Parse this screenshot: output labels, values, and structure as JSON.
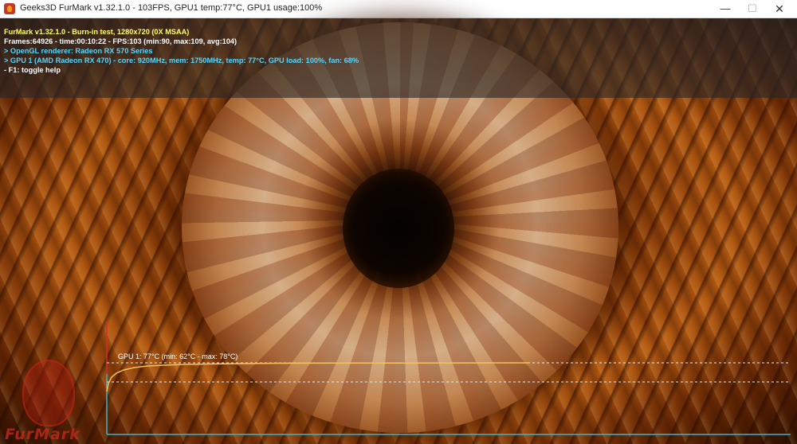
{
  "window": {
    "title": "Geeks3D FurMark v1.32.1.0 - 103FPS, GPU1 temp:77°C, GPU1 usage:100%",
    "minimize_icon": "minimize-icon",
    "maximize_icon": "maximize-icon",
    "close_icon": "close-icon"
  },
  "info": {
    "line1": "FurMark v1.32.1.0 - Burn-in test, 1280x720 (0X MSAA)",
    "line2": "Frames:64926 - time:00:10:22 - FPS:103 (min:90, max:109, avg:104)",
    "line3": "> OpenGL renderer: Radeon RX 570 Series",
    "line4": "> GPU 1 (AMD Radeon RX 470) - core: 920MHz, mem: 1750MHz, temp: 77°C, GPU load: 100%, fan: 68%",
    "line5": "- F1: toggle help"
  },
  "graph": {
    "label": "GPU 1: 77°C (min: 62°C - max: 78°C)",
    "current_temp_c": 77,
    "min_temp_c": 62,
    "max_temp_c": 78
  },
  "logo": {
    "text": "FurMark"
  },
  "colors": {
    "info_title": "#ffff66",
    "info_gpu": "#55d6ff",
    "graph_line": "#f5c060",
    "graph_axis": "#3fb4c8",
    "graph_marker": "#dd2a2a"
  }
}
